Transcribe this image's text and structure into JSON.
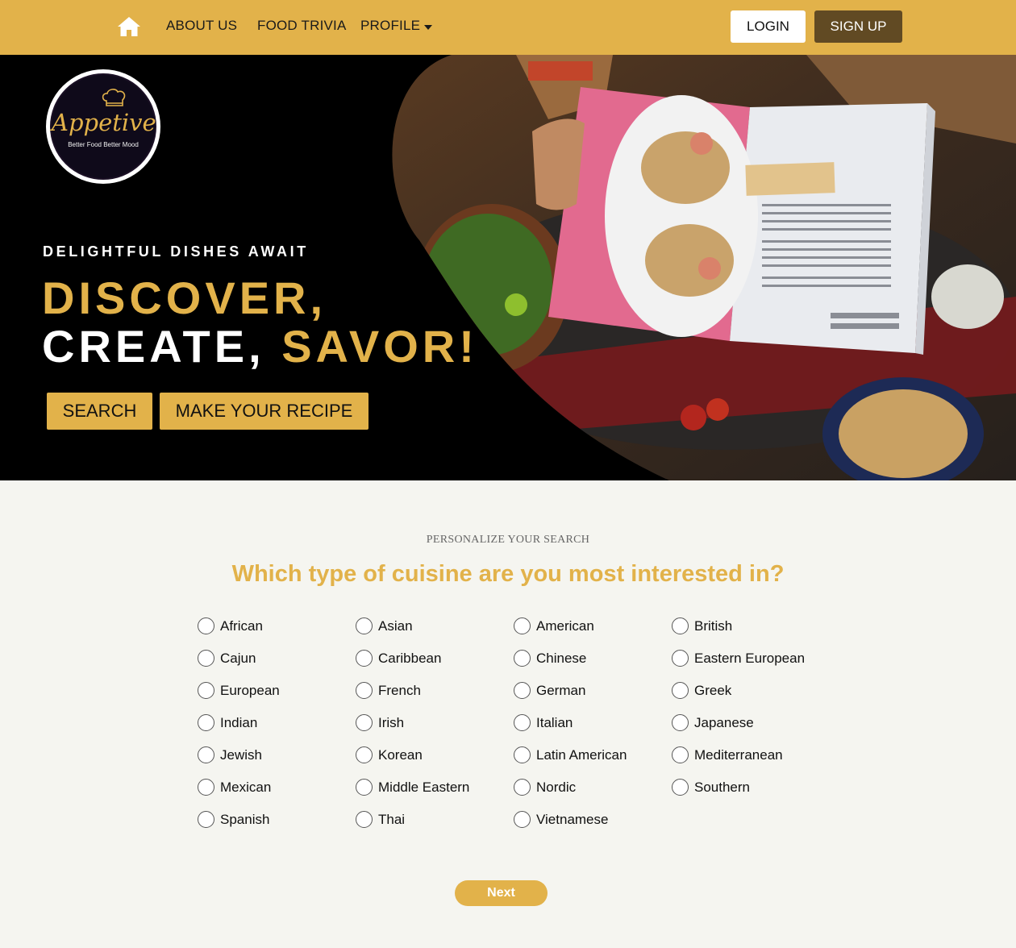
{
  "nav": {
    "home_icon": "home-icon",
    "about": "ABOUT US",
    "trivia": "FOOD TRIVIA",
    "profile": "PROFILE",
    "login": "LOGIN",
    "signup": "SIGN UP"
  },
  "hero": {
    "logo_text": "Appetive",
    "logo_tagline": "Better Food Better Mood",
    "eyebrow": "DELIGHTFUL DISHES AWAIT",
    "headline_1": "DISCOVER,",
    "headline_2a": "CREATE,",
    "headline_2b": "SAVOR!",
    "search_button": "SEARCH",
    "make_recipe_button": "MAKE YOUR RECIPE"
  },
  "quiz": {
    "eyebrow": "PERSONALIZE YOUR SEARCH",
    "question": "Which type of cuisine are you most interested in?",
    "options": [
      "African",
      "Asian",
      "American",
      "British",
      "Cajun",
      "Caribbean",
      "Chinese",
      "Eastern European",
      "European",
      "French",
      "German",
      "Greek",
      "Indian",
      "Irish",
      "Italian",
      "Japanese",
      "Jewish",
      "Korean",
      "Latin American",
      "Mediterranean",
      "Mexican",
      "Middle Eastern",
      "Nordic",
      "Southern",
      "Spanish",
      "Thai",
      "Vietnamese"
    ],
    "next_button": "Next"
  },
  "colors": {
    "accent": "#e2b24a",
    "signup_bg": "#614a23",
    "hero_bg": "#000000",
    "page_bg": "#f5f5f0"
  }
}
